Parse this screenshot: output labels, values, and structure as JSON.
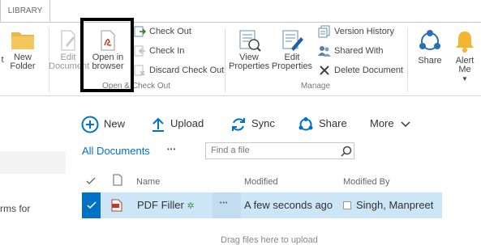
{
  "ribbon": {
    "tab_label": "LIBRARY",
    "new_folder_label": "New Folder",
    "edit_document_label": "Edit Document",
    "open_in_browser_label": "Open in browser",
    "check_out_label": "Check Out",
    "check_in_label": "Check In",
    "discard_check_out_label": "Discard Check Out",
    "group_open_check_out": "Open & Check Out",
    "view_properties_label": "View Properties",
    "edit_properties_label": "Edit Properties",
    "version_history_label": "Version History",
    "shared_with_label": "Shared With",
    "delete_document_label": "Delete Document",
    "group_manage": "Manage",
    "share_label": "Share",
    "alert_me_label": "Alert Me"
  },
  "commands": {
    "new_label": "New",
    "upload_label": "Upload",
    "sync_label": "Sync",
    "share_label": "Share",
    "more_label": "More"
  },
  "view": {
    "title": "All Documents",
    "ellipsis": "•••",
    "search_placeholder": "Find a file"
  },
  "left_fragment": "rms for",
  "table": {
    "headers": {
      "name": "Name",
      "modified": "Modified",
      "modified_by": "Modified By"
    },
    "rows": [
      {
        "name": "PDF Filler",
        "new_marker": "✲",
        "ellipsis": "•••",
        "modified": "A few seconds ago",
        "modified_by": "Singh, Manpreet"
      }
    ]
  },
  "drop_hint": "Drag files here to upload",
  "colors": {
    "accent": "#0072c6",
    "selected_row": "#cde6f7",
    "highlight_border": "#000000"
  }
}
